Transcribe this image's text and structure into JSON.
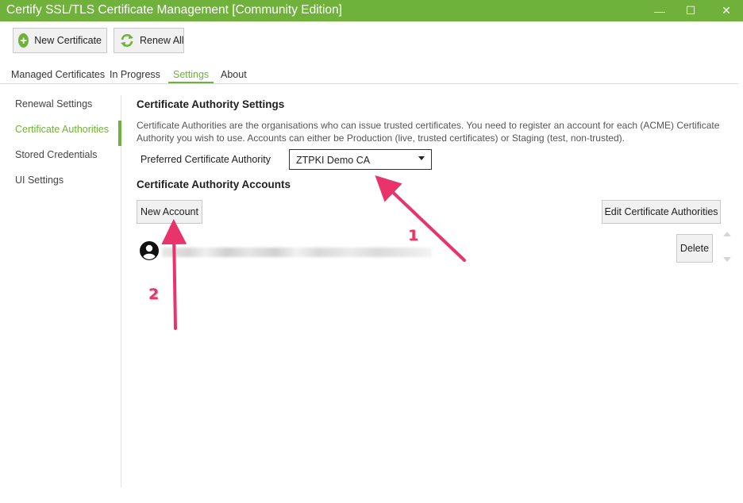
{
  "window": {
    "title": "Certify SSL/TLS Certificate Management [Community Edition]",
    "min_glyph": "—",
    "max_glyph": "☐",
    "close_glyph": "✕"
  },
  "toolbar": {
    "new_certificate_label": "New Certificate",
    "new_certificate_icon": "plus-circle-icon",
    "renew_all_label": "Renew All",
    "renew_all_icon": "refresh-icon"
  },
  "tabs": [
    {
      "label": "Managed Certificates",
      "active": false
    },
    {
      "label": "In Progress",
      "active": false
    },
    {
      "label": "Settings",
      "active": true
    },
    {
      "label": "About",
      "active": false
    }
  ],
  "sidebar": {
    "items": [
      {
        "label": "Renewal Settings",
        "active": false
      },
      {
        "label": "Certificate Authorities",
        "active": true
      },
      {
        "label": "Stored Credentials",
        "active": false
      },
      {
        "label": "UI Settings",
        "active": false
      }
    ]
  },
  "main": {
    "heading": "Certificate Authority Settings",
    "description": "Certificate Authorities are the organisations who can issue trusted certificates. You need to register an account for each (ACME) Certificate Authority you wish to use. Accounts can either be Production (live, trusted certificates) or Staging (test, non-trusted).",
    "preferred_ca_label": "Preferred Certificate Authority",
    "preferred_ca_value": "ZTPKI Demo CA",
    "accounts_heading": "Certificate Authority Accounts",
    "new_account_label": "New Account",
    "edit_ca_label": "Edit Certificate Authorities",
    "delete_label": "Delete"
  },
  "annotations": {
    "marker_1": "1",
    "marker_2": "2"
  },
  "colors": {
    "accent": "#70b13c",
    "annotation": "#e8336b"
  }
}
